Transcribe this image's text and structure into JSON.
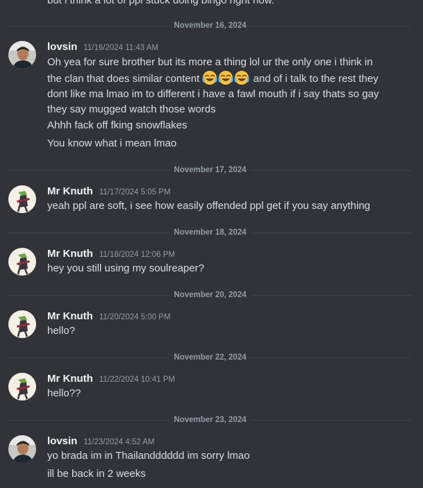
{
  "top_cut_text": "but i think a lot of ppl stuck doing bingo right now.",
  "groups": [
    {
      "date": "November 16, 2024",
      "user": "lovsin",
      "time": "11/16/2024 11:43 AM",
      "avatar_icon": "lovsin-avatar",
      "messages": [
        "Oh yea for sure brother but its more a thing lol ur the only one i think in the clan that does similar content",
        "and of i talk to the rest they dont like ma lmao im to different i have a fawl mouth if i say thats so gay they say mugged watch those words",
        "Ahhh fack off fking snowflakes",
        "You know what i mean lmao"
      ]
    },
    {
      "date": "November 17, 2024",
      "user": "Mr Knuth",
      "time": "11/17/2024 5:05 PM",
      "avatar_icon": "mrknuth-avatar",
      "messages": [
        "yeah ppl are soft, i see how easily offended ppl get if you say anything"
      ]
    },
    {
      "date": "November 18, 2024",
      "user": "Mr Knuth",
      "time": "11/18/2024 12:06 PM",
      "avatar_icon": "mrknuth-avatar",
      "messages": [
        "hey you still using my soulreaper?"
      ]
    },
    {
      "date": "November 20, 2024",
      "user": "Mr Knuth",
      "time": "11/20/2024 5:00 PM",
      "avatar_icon": "mrknuth-avatar",
      "messages": [
        "hello?"
      ]
    },
    {
      "date": "November 22, 2024",
      "user": "Mr Knuth",
      "time": "11/22/2024 10:41 PM",
      "avatar_icon": "mrknuth-avatar",
      "messages": [
        "hello??"
      ]
    },
    {
      "date": "November 23, 2024",
      "user": "lovsin",
      "time": "11/23/2024 4:52 AM",
      "avatar_icon": "lovsin-avatar",
      "messages": [
        "yo brada im in Thailandddddd im sorry lmao",
        "ill be back in 2 weeks"
      ]
    }
  ],
  "emoji_name": "joy-emoji",
  "colors": {
    "background": "#313338",
    "text": "#dbdee1",
    "muted": "#949ba4",
    "username": "#f2f3f5",
    "emoji": "#f7c24a"
  }
}
